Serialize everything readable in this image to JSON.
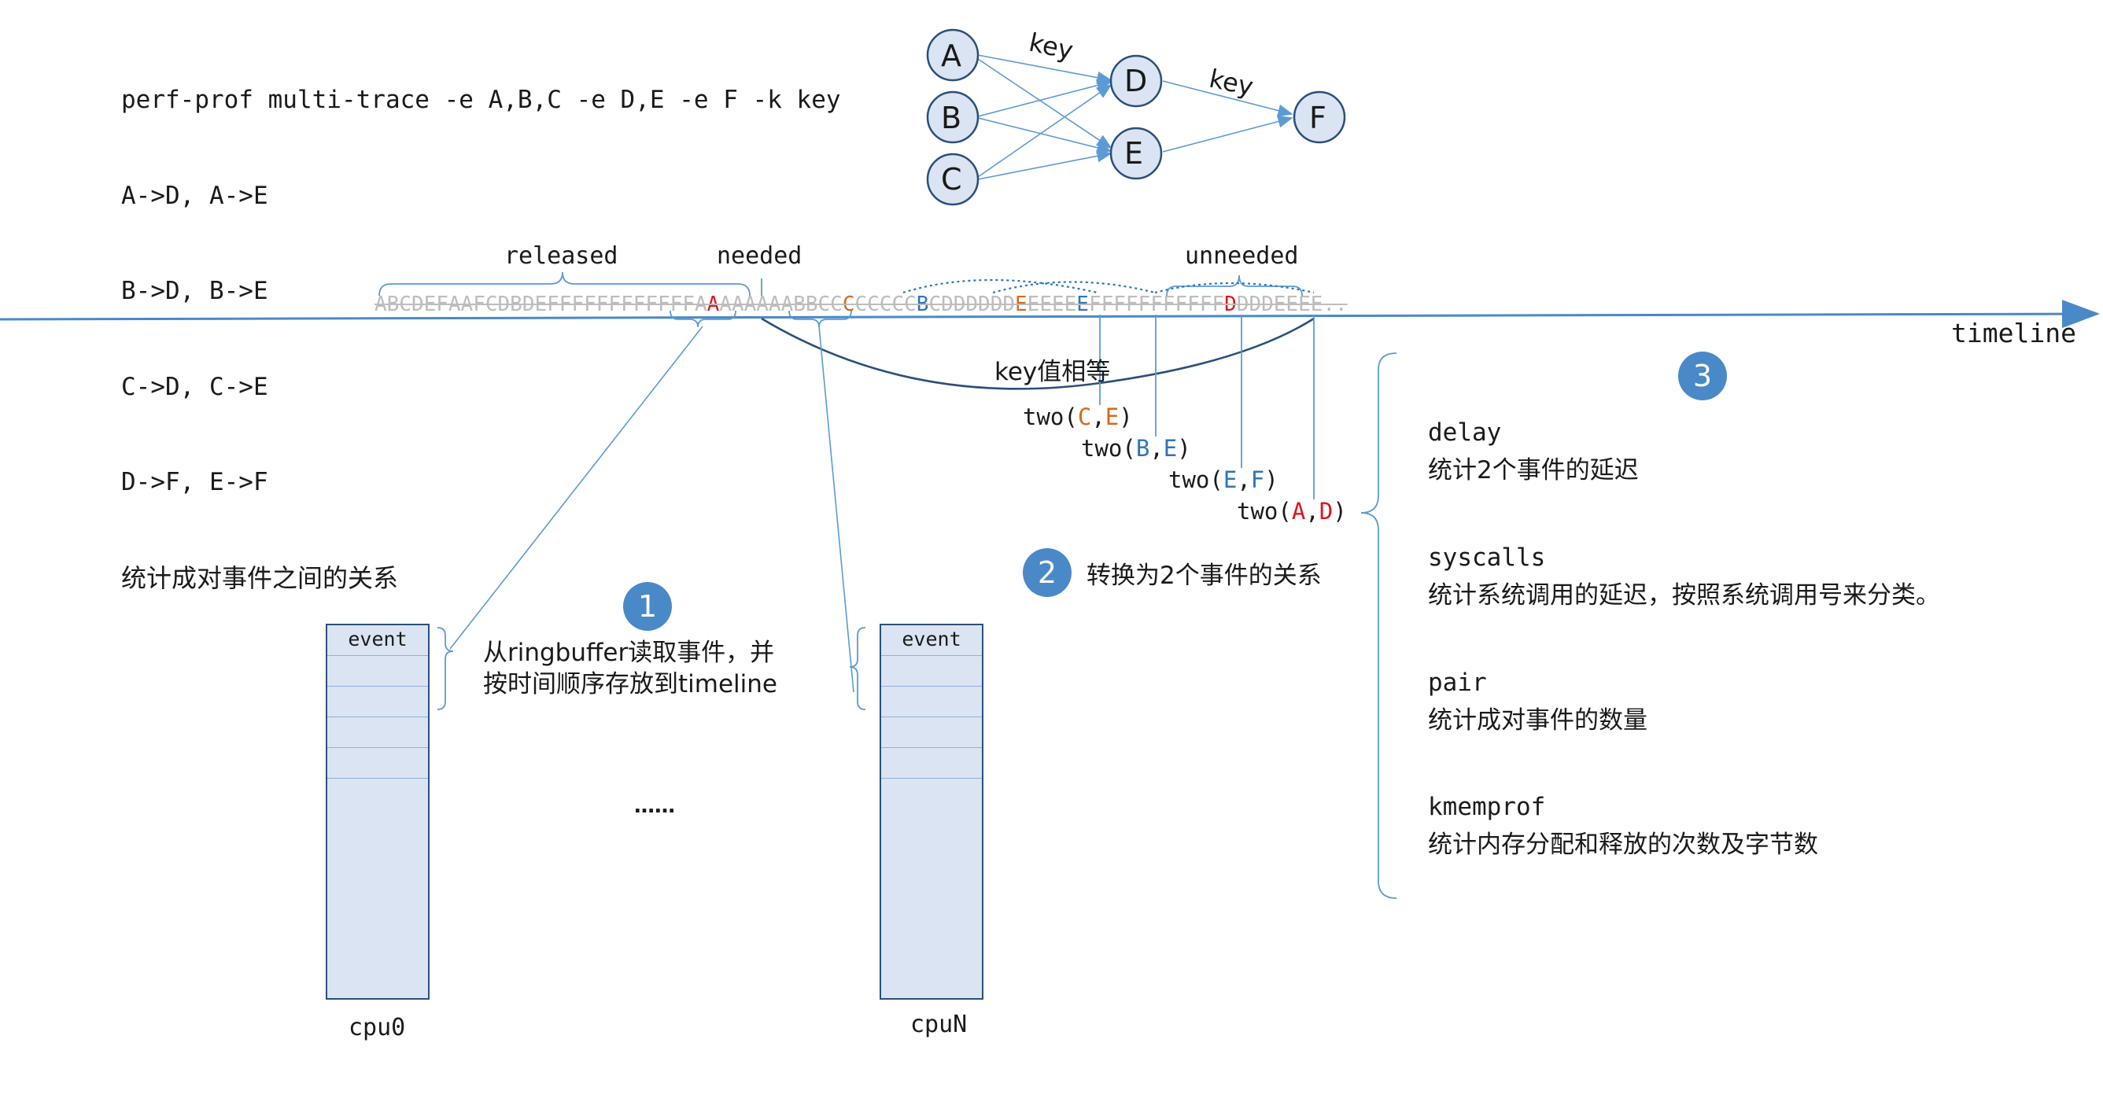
{
  "command": {
    "lines": [
      "perf-prof multi-trace -e A,B,C -e D,E -e F -k key",
      "A->D, A->E",
      "B->D, B->E",
      "C->D, C->E",
      "D->F, E->F"
    ],
    "caption": "统计成对事件之间的关系"
  },
  "graph": {
    "nodes": [
      "A",
      "B",
      "C",
      "D",
      "E",
      "F"
    ],
    "edge_labels": [
      "key",
      "key"
    ],
    "colors": {
      "node_fill": "#dbe4f3",
      "node_stroke": "#2b4f7a",
      "edge": "#5b9bd5"
    }
  },
  "timeline": {
    "labels": {
      "released": "released",
      "needed": "needed",
      "unneeded": "unneeded",
      "axis": "timeline"
    },
    "sequence": [
      {
        "text": "ABCDEFAAFCDBDEFFFFFFFFFFFFA",
        "style": "faded"
      },
      {
        "text": "A",
        "style": "red"
      },
      {
        "text": "AAAAAABBCC",
        "style": "faded"
      },
      {
        "text": "C",
        "style": "orange"
      },
      {
        "text": "CCCCC",
        "style": "faded"
      },
      {
        "text": "B",
        "style": "blue"
      },
      {
        "text": "CDDDDDD",
        "style": "faded"
      },
      {
        "text": "E",
        "style": "orange"
      },
      {
        "text": "EEEE",
        "style": "faded"
      },
      {
        "text": "E",
        "style": "blue"
      },
      {
        "text": "FFFFFFFFFFF",
        "style": "faded"
      },
      {
        "text": "D",
        "style": "red"
      },
      {
        "text": "DDDEEEE..",
        "style": "faded"
      }
    ],
    "key_equal": "key值相等",
    "pairs": [
      {
        "prefix": "two(",
        "a": "C",
        "sep": ",",
        "b": "E",
        "suffix": ")",
        "colors": [
          "orange",
          "orange"
        ]
      },
      {
        "prefix": "two(",
        "a": "B",
        "sep": ",",
        "b": "E",
        "suffix": ")",
        "colors": [
          "blue",
          "blue"
        ]
      },
      {
        "prefix": "two(",
        "a": "E",
        "sep": ",",
        "b": "F",
        "suffix": ")",
        "colors": [
          "blue",
          "blue"
        ]
      },
      {
        "prefix": "two(",
        "a": "A",
        "sep": ",",
        "b": "D",
        "suffix": ")",
        "colors": [
          "red",
          "red"
        ]
      }
    ]
  },
  "steps": {
    "one": {
      "num": "1",
      "text1": "从ringbuffer读取事件，并",
      "text2": "按时间顺序存放到timeline"
    },
    "two": {
      "num": "2",
      "text": "转换为2个事件的关系"
    },
    "three": {
      "num": "3"
    }
  },
  "cpus": {
    "cpu0": {
      "header": "event",
      "label": "cpu0"
    },
    "cpuN": {
      "header": "event",
      "label": "cpuN"
    },
    "ellipsis": "……"
  },
  "modes": [
    {
      "name": "delay",
      "desc": "统计2个事件的延迟"
    },
    {
      "name": "syscalls",
      "desc": "统计系统调用的延迟，按照系统调用号来分类。"
    },
    {
      "name": "pair",
      "desc": "统计成对事件的数量"
    },
    {
      "name": "kmemprof",
      "desc": "统计内存分配和释放的次数及字节数"
    }
  ],
  "palette": {
    "accent": "#4a89c8",
    "line": "#5b9bd5",
    "dark_line": "#2b4f7a",
    "red": "#e0161c",
    "orange": "#d46a1c",
    "blue": "#2e75b6",
    "faded": "#bdbdbd"
  }
}
